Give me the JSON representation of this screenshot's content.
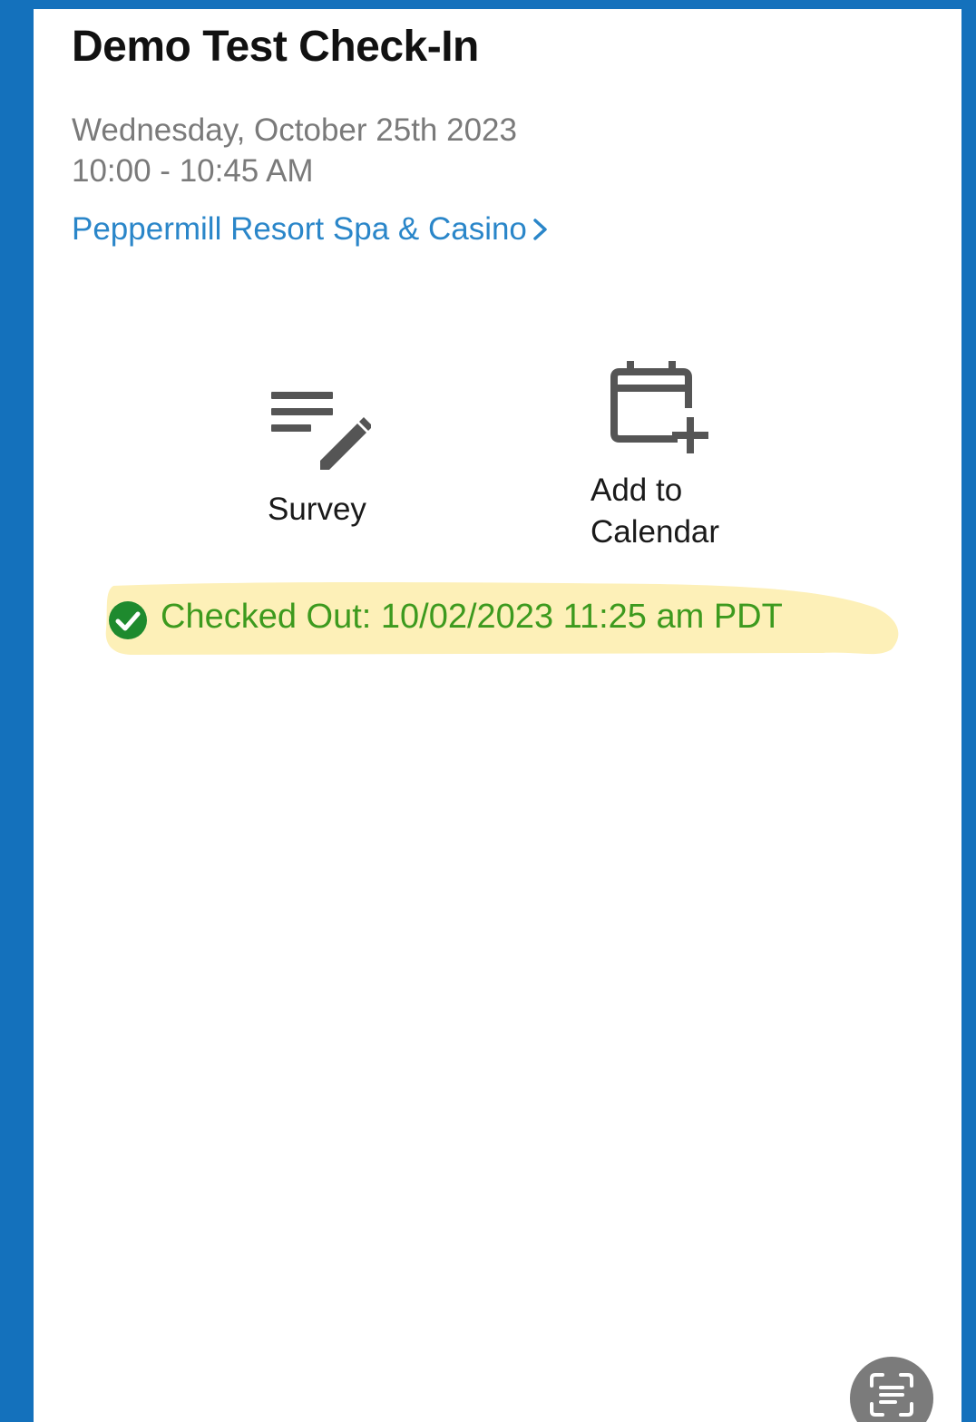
{
  "event": {
    "title": "Demo Test Check-In",
    "date": "Wednesday, October 25th 2023",
    "time": "10:00 - 10:45 AM",
    "location": "Peppermill Resort Spa & Casino"
  },
  "actions": {
    "survey_label": "Survey",
    "calendar_label_line1": "Add to",
    "calendar_label_line2": "Calendar"
  },
  "status": {
    "text": "Checked Out: 10/02/2023 11:25 am PDT",
    "color": "#3d9a1e",
    "icon": "check-circle-icon"
  },
  "colors": {
    "background": "#1471bc",
    "link": "#2a86c9",
    "highlight": "#fdf0b8"
  },
  "icons": {
    "survey": "survey-pencil-icon",
    "calendar": "calendar-add-icon",
    "location_chevron": "chevron-right-icon",
    "scan": "text-scan-icon"
  }
}
